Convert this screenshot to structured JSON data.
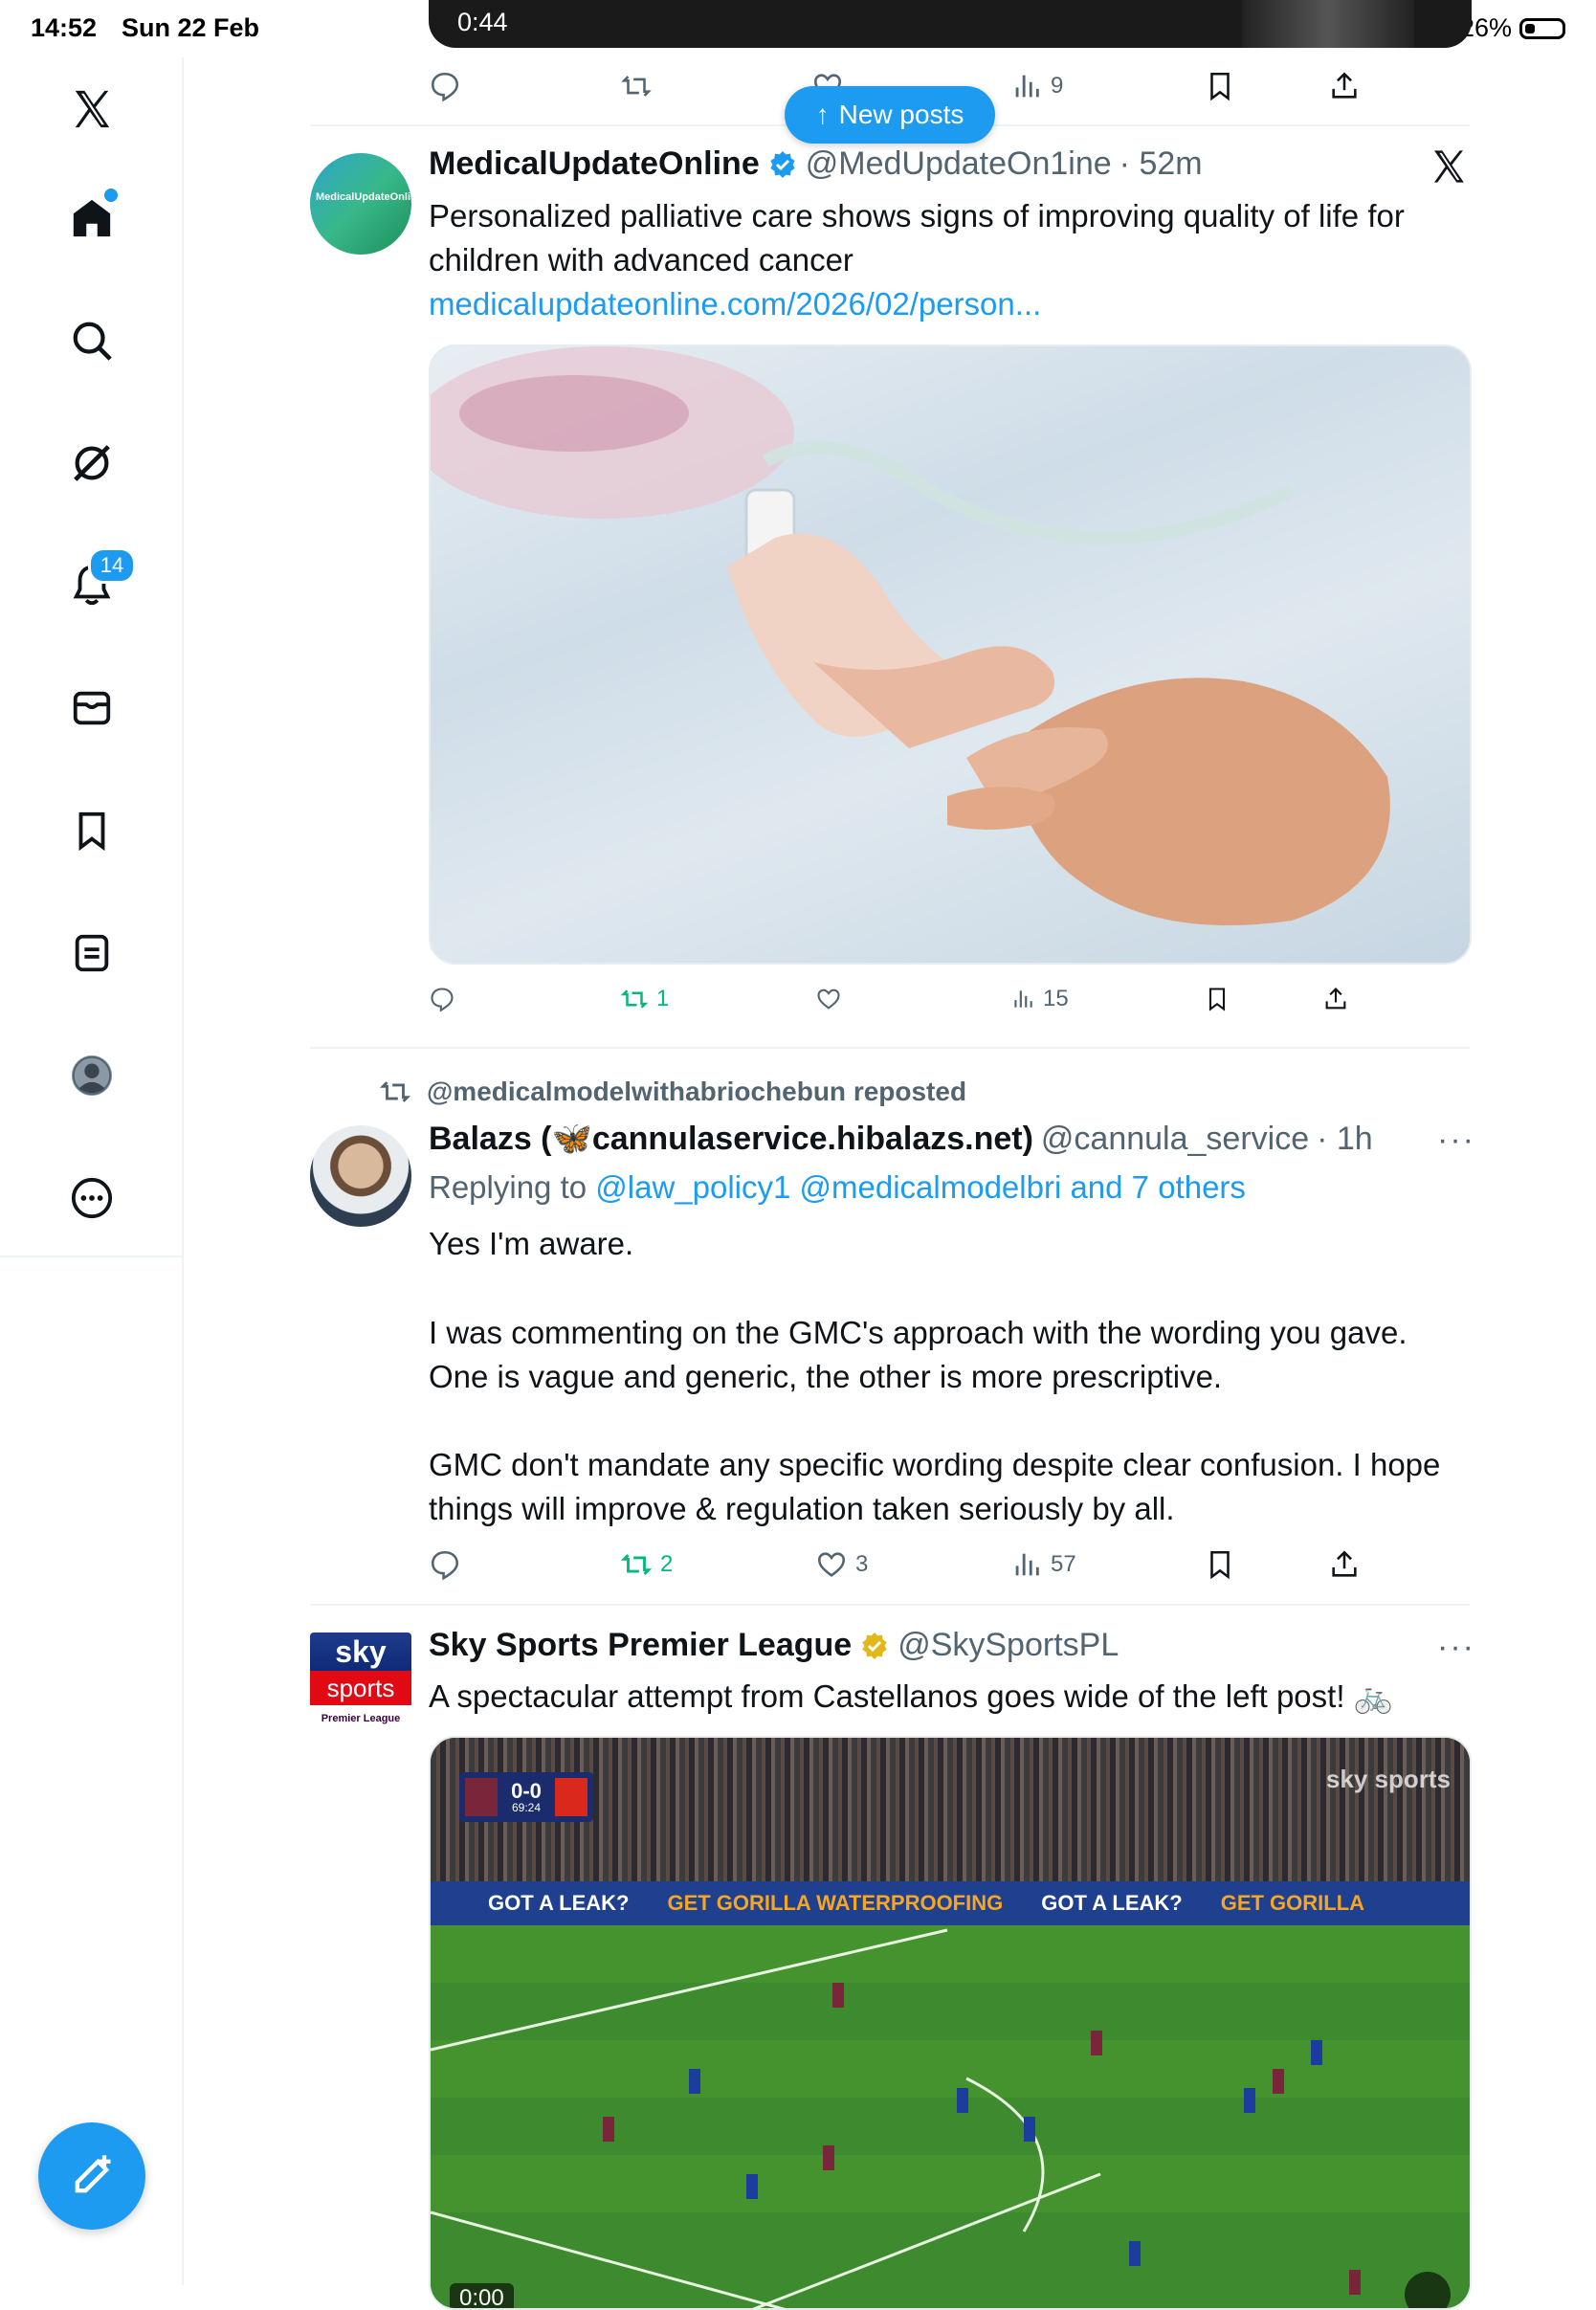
{
  "status_bar": {
    "time": "14:52",
    "date": "Sun 22 Feb",
    "battery": "26%"
  },
  "new_posts_label": "New posts",
  "notifications_count": "14",
  "top_video": {
    "time": "0:44",
    "views": "9"
  },
  "tweet1": {
    "name": "MedicalUpdateOnline",
    "handle": "@MedUpdateOn1ine",
    "time": "· 52m",
    "avatar_text": "MedicalUpdateOnline",
    "text": "Personalized palliative care shows signs of improving quality of life for children with advanced cancer ",
    "link": "medicalupdateonline.com/2026/02/person...",
    "retweets": "1",
    "views": "15"
  },
  "tweet2": {
    "repost_label": "@medicalmodelwithabriochebun reposted",
    "name": "Balazs (🦋cannulaservice.hibalazs.net)",
    "handle": "@cannula_service",
    "time": "· 1h",
    "replying_prefix": "Replying to ",
    "replying_to": "@law_policy1 @medicalmodelbri and 7 others",
    "para1": "Yes I'm aware.",
    "para2": "I was commenting on the GMC's approach with the wording you gave. One is vague and generic, the other is more prescriptive.",
    "para3": "GMC don't mandate any specific wording despite clear confusion. I hope things will improve & regulation taken seriously by all.",
    "retweets": "2",
    "likes": "3",
    "views": "57"
  },
  "tweet3": {
    "name": "Sky Sports Premier League",
    "handle": "@SkySportsPL",
    "text": "A spectacular attempt from Castellanos goes wide of the left post! 🚲",
    "avatar_top": "sky",
    "avatar_bottom": "sports",
    "avatar_league": "Premier League",
    "score": "0-0",
    "clock": "69:24",
    "watermark": "sky sports",
    "ad1": "GOT A LEAK?",
    "ad2": "GET GORILLA WATERPROOFING",
    "ad3": "GOT A LEAK?",
    "ad4": "GET GORILLA",
    "video_time": "0:00"
  },
  "colors": {
    "accent": "#1d9bf0",
    "retweet_green": "#00ba7c",
    "verified_gold": "#e2b719"
  }
}
